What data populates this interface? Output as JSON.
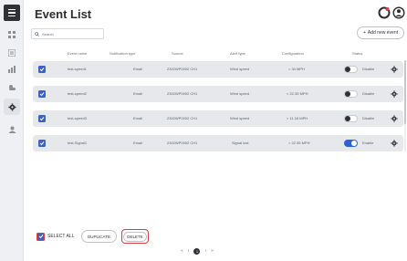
{
  "page": {
    "title": "Event List"
  },
  "search": {
    "placeholder": "Search"
  },
  "toolbar": {
    "add_label": "Add new event",
    "add_icon": "plus-icon"
  },
  "table": {
    "columns": [
      "Event name",
      "Notification type",
      "Source",
      "Alert type",
      "Configuration",
      "Status"
    ],
    "rows": [
      {
        "event_name": "test-speed1",
        "notification": "Email",
        "source": "2302WP0002 CH1",
        "alert_type": "Wind speed",
        "configuration": "> 34 MPH",
        "status": "Disable",
        "enabled": false,
        "checked": true
      },
      {
        "event_name": "test-speed2",
        "notification": "Email",
        "source": "2302WP0002 CH1",
        "alert_type": "Wind speed",
        "configuration": "< 22.35 MPH",
        "status": "Disable",
        "enabled": false,
        "checked": true
      },
      {
        "event_name": "test-speed3",
        "notification": "Email",
        "source": "2302WP0002 CH1",
        "alert_type": "Wind speed",
        "configuration": "> 11.16 MPH",
        "status": "Disable",
        "enabled": false,
        "checked": true
      },
      {
        "event_name": "test-Signal1",
        "notification": "Email",
        "source": "2302WP0002 CH1",
        "alert_type": "Signal lost",
        "configuration": "> 22.35 MPH",
        "status": "Enable",
        "enabled": true,
        "checked": true
      }
    ]
  },
  "actions": {
    "select_all": "SELECT ALL",
    "duplicate": "DUPLICATE",
    "delete": "DELETE"
  },
  "pagination": {
    "first": "«",
    "prev": "‹",
    "current": "1",
    "next": "›",
    "last": "»"
  },
  "colors": {
    "accent": "#2d63d3",
    "highlight": "#e23b3b",
    "row_bg": "#e6e8ec"
  }
}
